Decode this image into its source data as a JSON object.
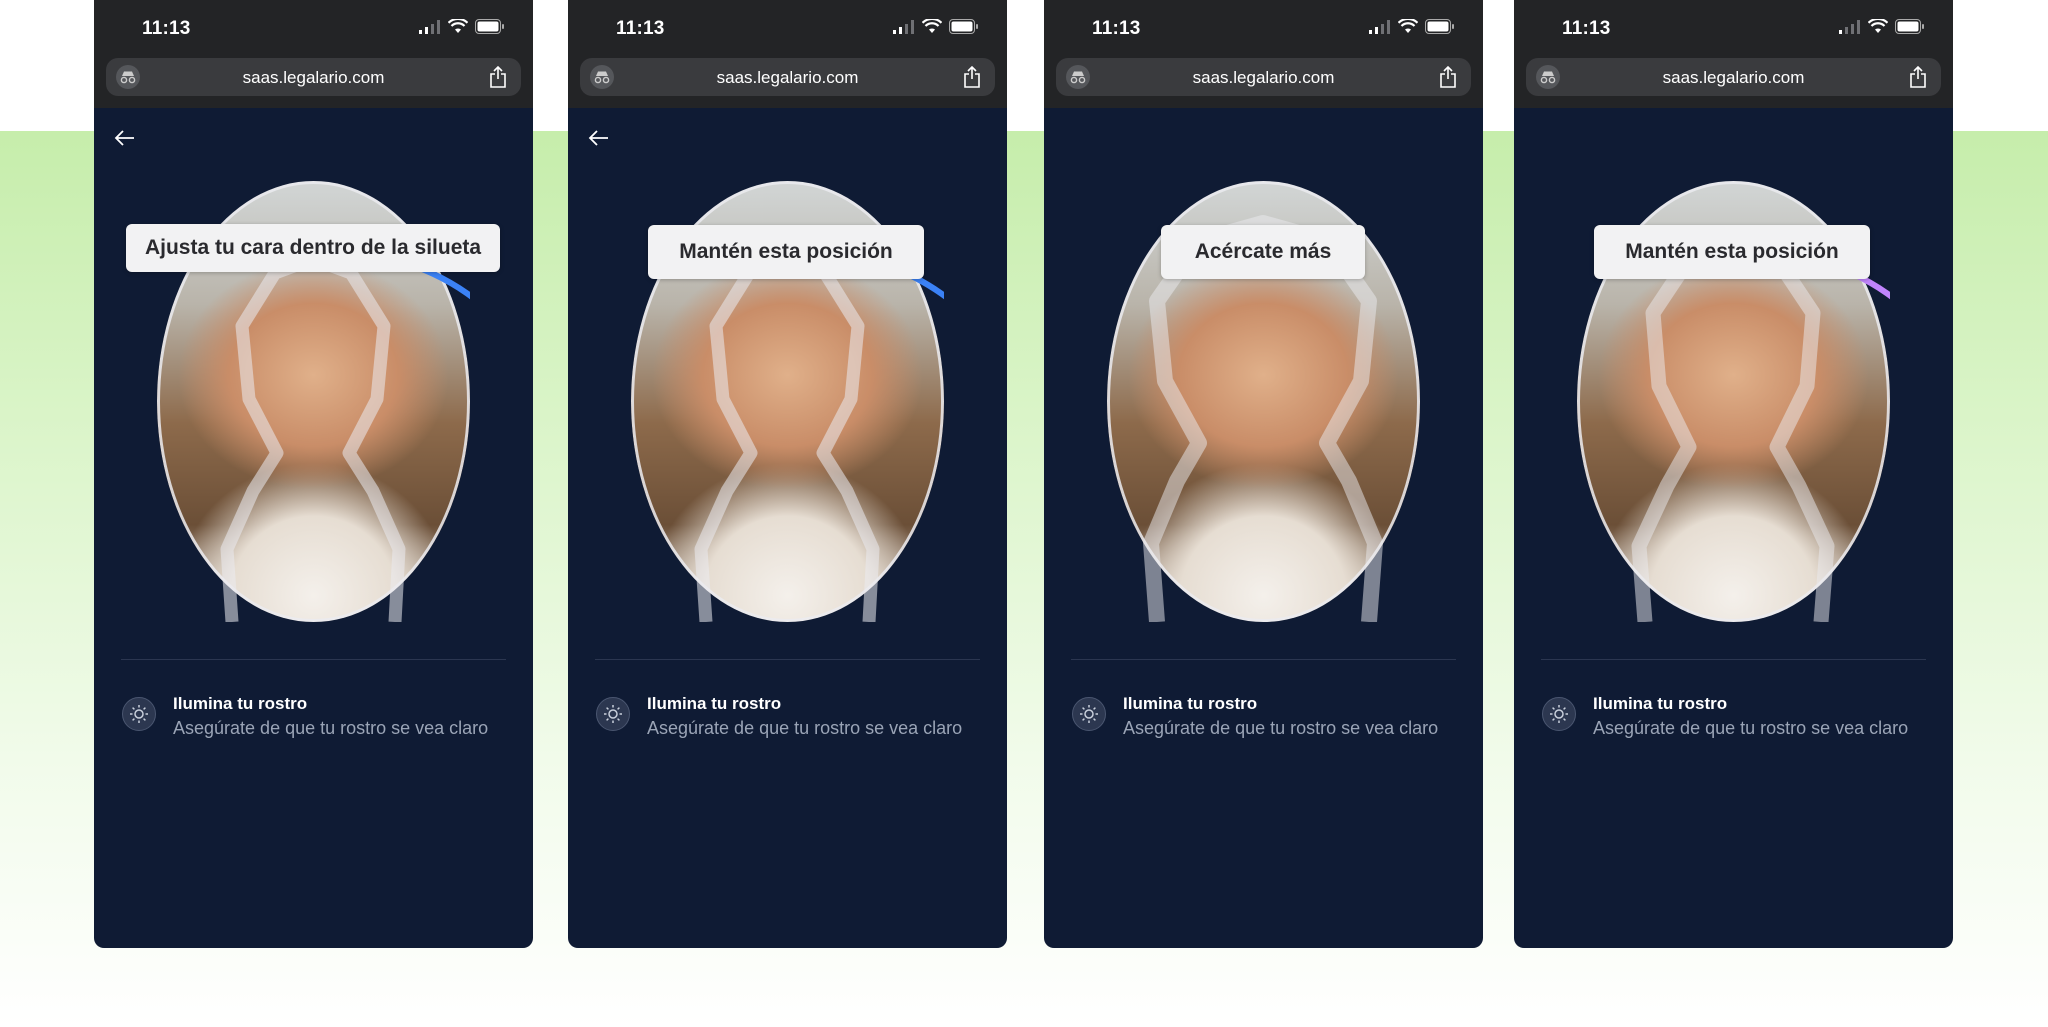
{
  "accent_colors": {
    "progress_blue": "#3b82f6",
    "progress_purple": "#c084fc",
    "panel_bg": "#0f1b34"
  },
  "phones": [
    {
      "status": {
        "time": "11:13"
      },
      "browser": {
        "url": "saas.legalario.com"
      },
      "instruction": "Ajusta tu cara dentro de la silueta",
      "tip": {
        "title": "Ilumina tu rostro",
        "subtitle": "Asegúrate de que tu rostro se vea claro"
      },
      "icons": [
        "back-arrow-icon",
        "privacy-mask-icon",
        "share-icon",
        "sun-icon"
      ]
    },
    {
      "status": {
        "time": "11:13"
      },
      "browser": {
        "url": "saas.legalario.com"
      },
      "instruction": "Mantén esta posición",
      "tip": {
        "title": "Ilumina tu rostro",
        "subtitle": "Asegúrate de que tu rostro se vea claro"
      }
    },
    {
      "status": {
        "time": "11:13"
      },
      "browser": {
        "url": "saas.legalario.com"
      },
      "instruction": "Acércate más",
      "tip": {
        "title": "Ilumina tu rostro",
        "subtitle": "Asegúrate de que tu rostro se vea claro"
      }
    },
    {
      "status": {
        "time": "11:13"
      },
      "browser": {
        "url": "saas.legalario.com"
      },
      "instruction": "Mantén esta posición",
      "tip": {
        "title": "Ilumina tu rostro",
        "subtitle": "Asegúrate de que tu rostro se vea claro"
      }
    }
  ]
}
